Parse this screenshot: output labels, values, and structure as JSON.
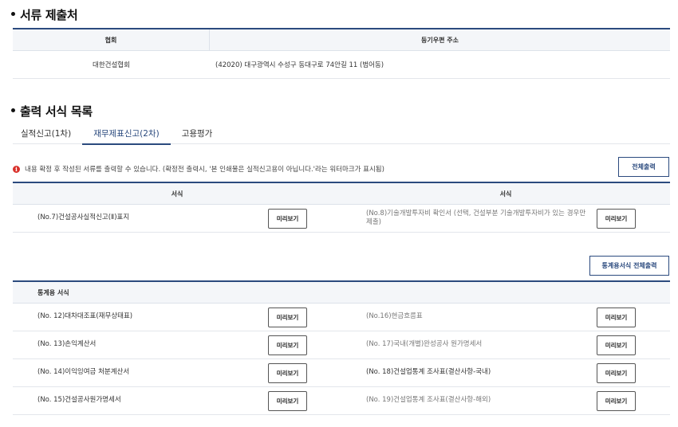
{
  "submit_section": {
    "title": "서류 제출처",
    "headers": [
      "협회",
      "등기우편 주소"
    ],
    "rows": [
      {
        "org": "대한건설협회",
        "address": "(42020) 대구광역시 수성구 동대구로 74안길 11 (범어동)"
      }
    ]
  },
  "forms_section": {
    "title": "출력 서식 목록",
    "tabs": [
      {
        "label": "실적신고(1차)",
        "active": false
      },
      {
        "label": "재무제표신고(2차)",
        "active": true
      },
      {
        "label": "고용평가",
        "active": false
      }
    ],
    "notice": "내용 확정 후 작성된 서류를 출력할 수 있습니다. (확정전 출력시, '본 인쇄물은 실적신고용이 아닙니다.'라는 워터마크가 표시됨)",
    "print_all_button": "전체출력",
    "table1": {
      "headers": [
        "서식",
        "서식"
      ],
      "rows": [
        {
          "left": {
            "label": "(No.7)건설공사실적신고(Ⅱ)표지",
            "button": "미리보기",
            "gray": false
          },
          "right": {
            "label": "(No.8)기술개발투자비 확인서 (선택, 건설부분 기술개발투자비가 있는 경우만 제출)",
            "button": "미리보기",
            "gray": true
          }
        }
      ]
    },
    "stats_print_all_button": "통계용서식 전체출력",
    "table2": {
      "header": "통계용 서식",
      "rows": [
        {
          "left": {
            "label": "(No. 12)대차대조표(재무상태표)",
            "button": "미리보기",
            "gray": false
          },
          "right": {
            "label": "(No.16)현금흐름표",
            "button": "미리보기",
            "gray": true
          }
        },
        {
          "left": {
            "label": "(No. 13)손익계산서",
            "button": "미리보기",
            "gray": false
          },
          "right": {
            "label": "(No. 17)국내(개별)완성공사 원가명세서",
            "button": "미리보기",
            "gray": true
          }
        },
        {
          "left": {
            "label": "(No. 14)이익잉여금 처분계산서",
            "button": "미리보기",
            "gray": false
          },
          "right": {
            "label": "(No. 18)건설업통계 조사표(결산사항-국내)",
            "button": "미리보기",
            "gray": false
          }
        },
        {
          "left": {
            "label": "(No. 15)건설공사원가명세서",
            "button": "미리보기",
            "gray": false
          },
          "right": {
            "label": "(No. 19)건설업통계 조사표(결산사항-해외)",
            "button": "미리보기",
            "gray": true
          }
        }
      ]
    }
  },
  "colors": {
    "accent": "#2b4a7e",
    "notice_icon": "#d9312b"
  },
  "icons": {
    "notice": "info-icon"
  }
}
